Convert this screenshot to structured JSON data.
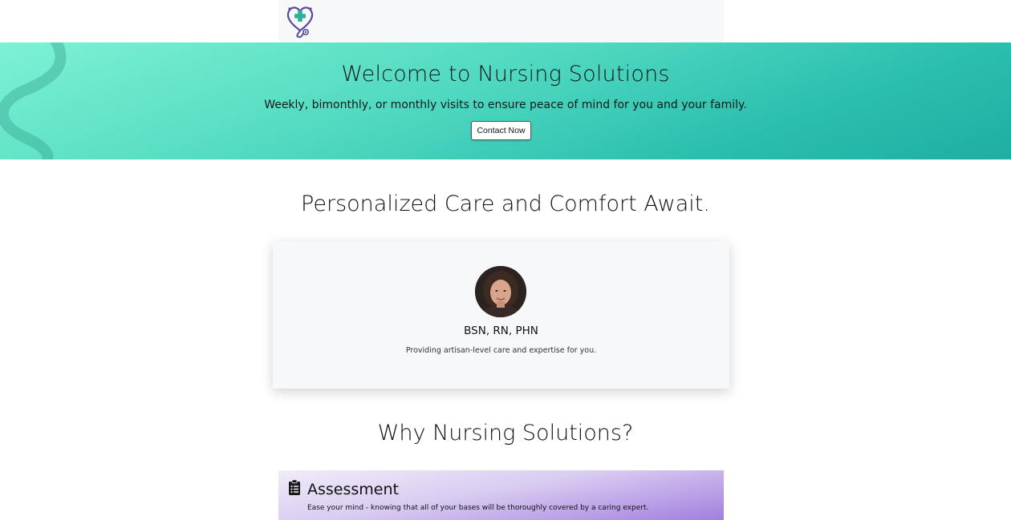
{
  "navbar": {
    "logo_icon": "stethoscope-heart-logo-icon"
  },
  "hero": {
    "title": "Welcome to Nursing Solutions",
    "subtitle": "Weekly, bimonthly, or monthly visits to ensure peace of mind for you and your family.",
    "cta_label": "Contact Now"
  },
  "care_section": {
    "title": "Personalized Care and Comfort Await.",
    "profile": {
      "credentials": "BSN, RN, PHN",
      "tagline": "Providing artisan-level care and expertise for you."
    }
  },
  "why_section": {
    "title": "Why Nursing Solutions?",
    "features": [
      {
        "icon": "clipboard-list-icon",
        "title": "Assessment",
        "description": "Ease your mind - knowing that all of your bases will be thoroughly covered by a caring expert."
      }
    ]
  },
  "colors": {
    "hero_gradient_start": "#7df2d3",
    "hero_gradient_end": "#1eaea2",
    "feature_gradient_start": "#f1ecfa",
    "feature_gradient_end": "#a27fde",
    "logo_cross": "#2bb39a",
    "logo_stethoscope": "#5a4a9c"
  }
}
